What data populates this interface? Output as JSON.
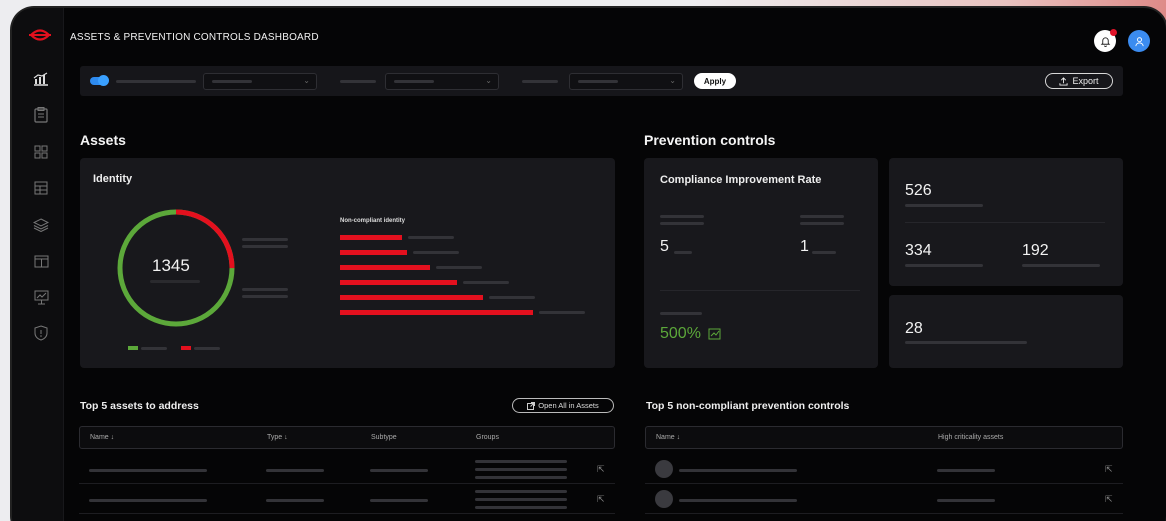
{
  "app": {
    "title": "ASSETS & PREVENTION CONTROLS DASHBOARD"
  },
  "colors": {
    "accent": "#2e8bf0",
    "danger": "#e3101e",
    "success": "#5ca83a",
    "background": "#050506",
    "card": "#18181c"
  },
  "icons": {
    "logo": "brand-logo-icon",
    "nav": [
      "dashboard-chart-icon",
      "clipboard-icon",
      "grid-icon",
      "table-icon",
      "layers-icon",
      "window-icon",
      "presentation-chart-icon",
      "shield-icon"
    ],
    "header": [
      "bell-icon",
      "user-icon"
    ]
  },
  "filters": {
    "apply_label": "Apply",
    "export_label": "Export"
  },
  "assets": {
    "title": "Assets",
    "identity": {
      "title": "Identity",
      "total": "1345",
      "donut": {
        "compliant_fraction": 0.75,
        "non_compliant_fraction": 0.25
      },
      "bars_title": "Non-compliant identity",
      "bar_values": [
        0.27,
        0.29,
        0.39,
        0.51,
        0.62,
        0.84
      ]
    }
  },
  "prevention": {
    "title": "Prevention controls",
    "compliance": {
      "title": "Compliance Improvement Rate",
      "left_value": "5",
      "right_value": "1",
      "rate": "500%"
    },
    "stats_top": {
      "total": "526",
      "left": "334",
      "right": "192"
    },
    "stats_bottom": {
      "value": "28"
    }
  },
  "top_assets": {
    "title": "Top 5 assets to address",
    "open_all_label": "Open All in Assets",
    "columns": [
      "Name ↓",
      "Type ↓",
      "Subtype",
      "Groups"
    ]
  },
  "top_controls": {
    "title": "Top 5 non-compliant prevention controls",
    "columns": [
      "Name ↓",
      "High criticality assets"
    ]
  }
}
